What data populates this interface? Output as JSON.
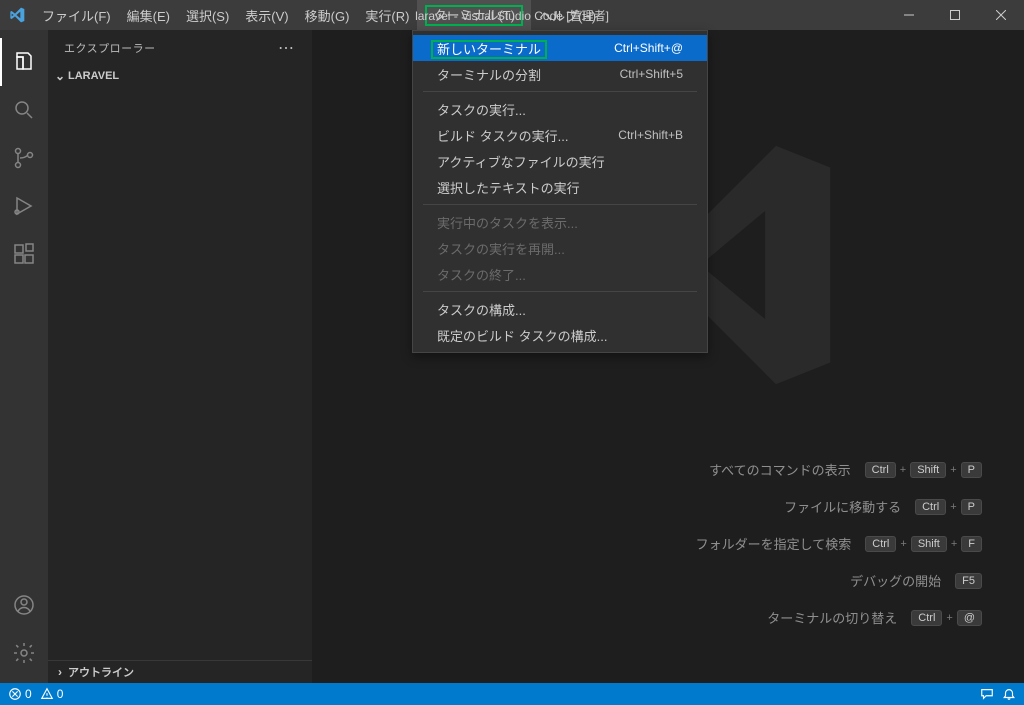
{
  "title": "laravel - Visual Studio Code [管理者]",
  "menubar": [
    "ファイル(F)",
    "編集(E)",
    "選択(S)",
    "表示(V)",
    "移動(G)",
    "実行(R)",
    "ターミナル(T)",
    "ヘルプ(H)"
  ],
  "menubar_open_index": 6,
  "sidebar": {
    "title": "エクスプローラー",
    "project": "LARAVEL",
    "outline": "アウトライン"
  },
  "dropdown": {
    "items": [
      {
        "label": "新しいターミナル",
        "shortcut": "Ctrl+Shift+@",
        "selected": true,
        "highlighted": true
      },
      {
        "label": "ターミナルの分割",
        "shortcut": "Ctrl+Shift+5"
      },
      {
        "sep": true
      },
      {
        "label": "タスクの実行..."
      },
      {
        "label": "ビルド タスクの実行...",
        "shortcut": "Ctrl+Shift+B"
      },
      {
        "label": "アクティブなファイルの実行"
      },
      {
        "label": "選択したテキストの実行"
      },
      {
        "sep": true
      },
      {
        "label": "実行中のタスクを表示...",
        "disabled": true
      },
      {
        "label": "タスクの実行を再開...",
        "disabled": true
      },
      {
        "label": "タスクの終了...",
        "disabled": true
      },
      {
        "sep": true
      },
      {
        "label": "タスクの構成..."
      },
      {
        "label": "既定のビルド タスクの構成..."
      }
    ]
  },
  "welcome": {
    "shortcuts": [
      {
        "label": "すべてのコマンドの表示",
        "keys": [
          "Ctrl",
          "Shift",
          "P"
        ]
      },
      {
        "label": "ファイルに移動する",
        "keys": [
          "Ctrl",
          "P"
        ]
      },
      {
        "label": "フォルダーを指定して検索",
        "keys": [
          "Ctrl",
          "Shift",
          "F"
        ]
      },
      {
        "label": "デバッグの開始",
        "keys": [
          "F5"
        ]
      },
      {
        "label": "ターミナルの切り替え",
        "keys": [
          "Ctrl",
          "@"
        ]
      }
    ]
  },
  "statusbar": {
    "errors": "0",
    "warnings": "0"
  }
}
